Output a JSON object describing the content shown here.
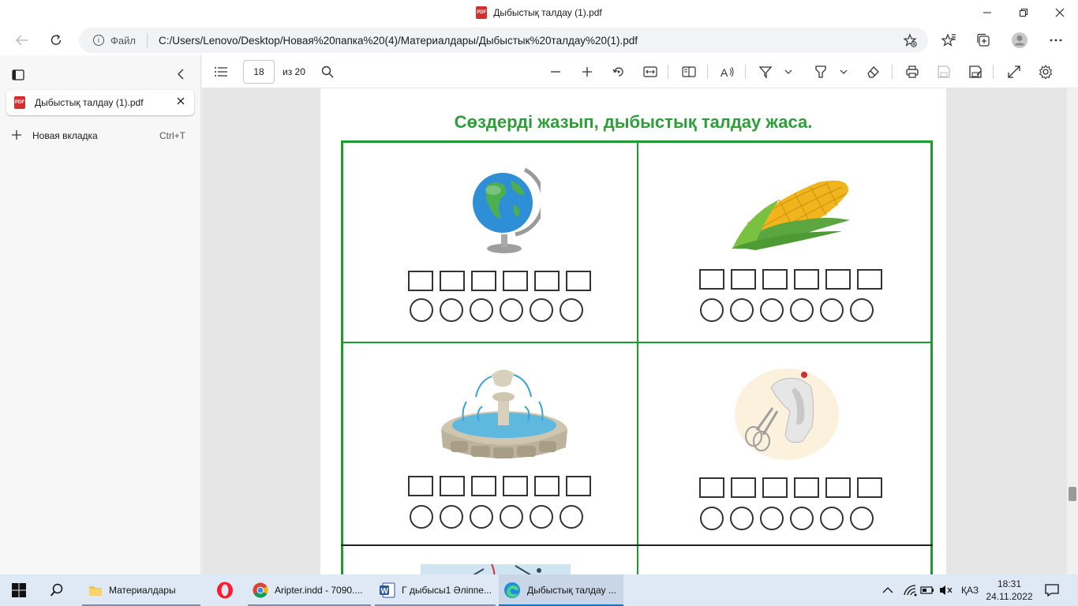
{
  "window": {
    "title": "Дыбыстық талдау (1).pdf"
  },
  "addressbar": {
    "scheme_label": "Файл",
    "url": "C:/Users/Lenovo/Desktop/Новая%20папка%20(4)/Материалдары/Дыбыстык%20талдау%20(1).pdf"
  },
  "sidebar": {
    "active_tab_label": "Дыбыстық талдау (1).pdf",
    "new_tab_label": "Новая вкладка",
    "new_tab_shortcut": "Ctrl+T"
  },
  "pdf_toolbar": {
    "current_page": "18",
    "page_count_label": "из 20"
  },
  "document": {
    "heading": "Сөздерді жазып, дыбыстық талдау жаса."
  },
  "taskbar": {
    "items": [
      {
        "label": "Материалдары"
      },
      {
        "label": "Aripter.indd - 7090...."
      },
      {
        "label": "Г дыбысы1 Әліппе..."
      },
      {
        "label": "Дыбыстық талдау ..."
      }
    ],
    "language": "ҚАЗ",
    "time": "18:31",
    "date": "24.11.2022"
  },
  "colors": {
    "heading_green": "#2e9e3a",
    "grid_green": "#1f9a2c",
    "pdf_red": "#d32f2f"
  }
}
